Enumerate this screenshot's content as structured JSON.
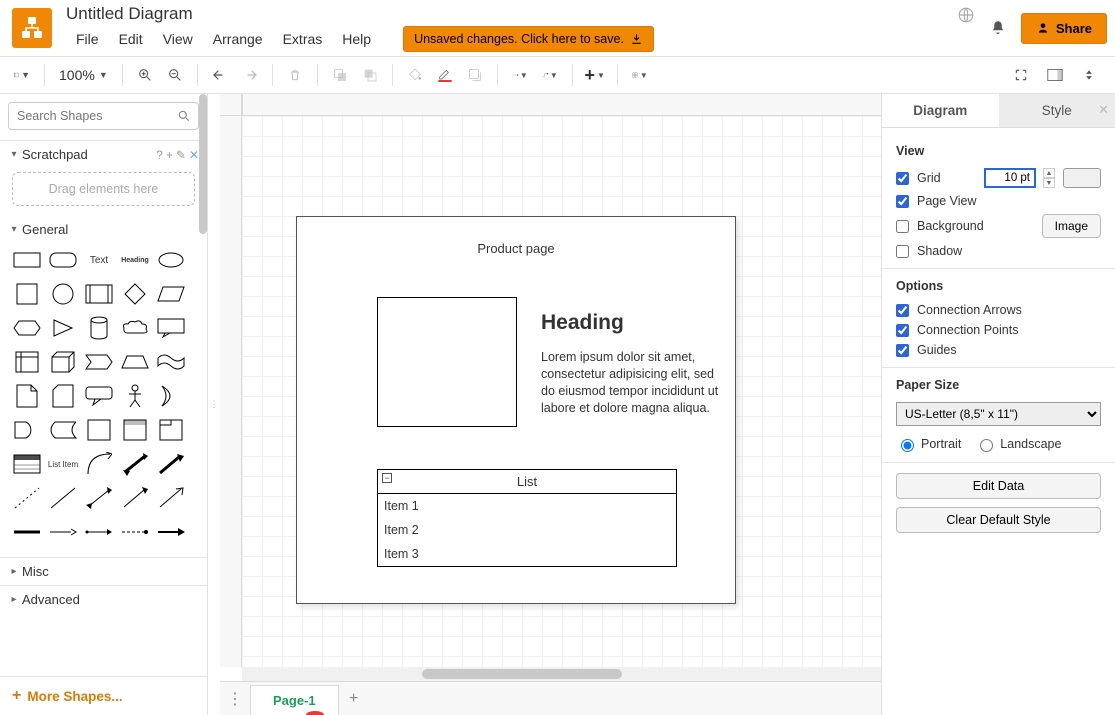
{
  "header": {
    "doc_title": "Untitled Diagram",
    "menus": [
      "File",
      "Edit",
      "View",
      "Arrange",
      "Extras",
      "Help"
    ],
    "unsaved_label": "Unsaved changes. Click here to save.",
    "share_label": "Share"
  },
  "toolbar": {
    "zoom_label": "100%"
  },
  "left": {
    "search_placeholder": "Search Shapes",
    "scratchpad_label": "Scratchpad",
    "scratchpad_hint": "Drag elements here",
    "general_label": "General",
    "text_thumb_label": "Text",
    "heading_thumb_label": "Heading",
    "listitem_thumb_label": "List Item",
    "misc_label": "Misc",
    "advanced_label": "Advanced",
    "moreshapes_label": "More Shapes..."
  },
  "canvas": {
    "page_title": "Product page",
    "heading": "Heading",
    "lorem": "Lorem ipsum dolor sit amet, consectetur adipisicing elit, sed do eiusmod tempor incididunt ut labore et dolore magna aliqua.",
    "list_title": "List",
    "list_items": [
      "Item 1",
      "Item 2",
      "Item 3"
    ]
  },
  "tabs": {
    "page1_label": "Page-1"
  },
  "right": {
    "tabs": {
      "diagram": "Diagram",
      "style": "Style"
    },
    "view_heading": "View",
    "grid_label": "Grid",
    "grid_value": "10 pt",
    "pageview_label": "Page View",
    "background_label": "Background",
    "image_btn": "Image",
    "shadow_label": "Shadow",
    "options_heading": "Options",
    "connarrows_label": "Connection Arrows",
    "connpoints_label": "Connection Points",
    "guides_label": "Guides",
    "papersize_heading": "Paper Size",
    "papersize_selected": "US-Letter (8,5\" x 11\")",
    "portrait_label": "Portrait",
    "landscape_label": "Landscape",
    "editdata_label": "Edit Data",
    "cleardefault_label": "Clear Default Style"
  }
}
